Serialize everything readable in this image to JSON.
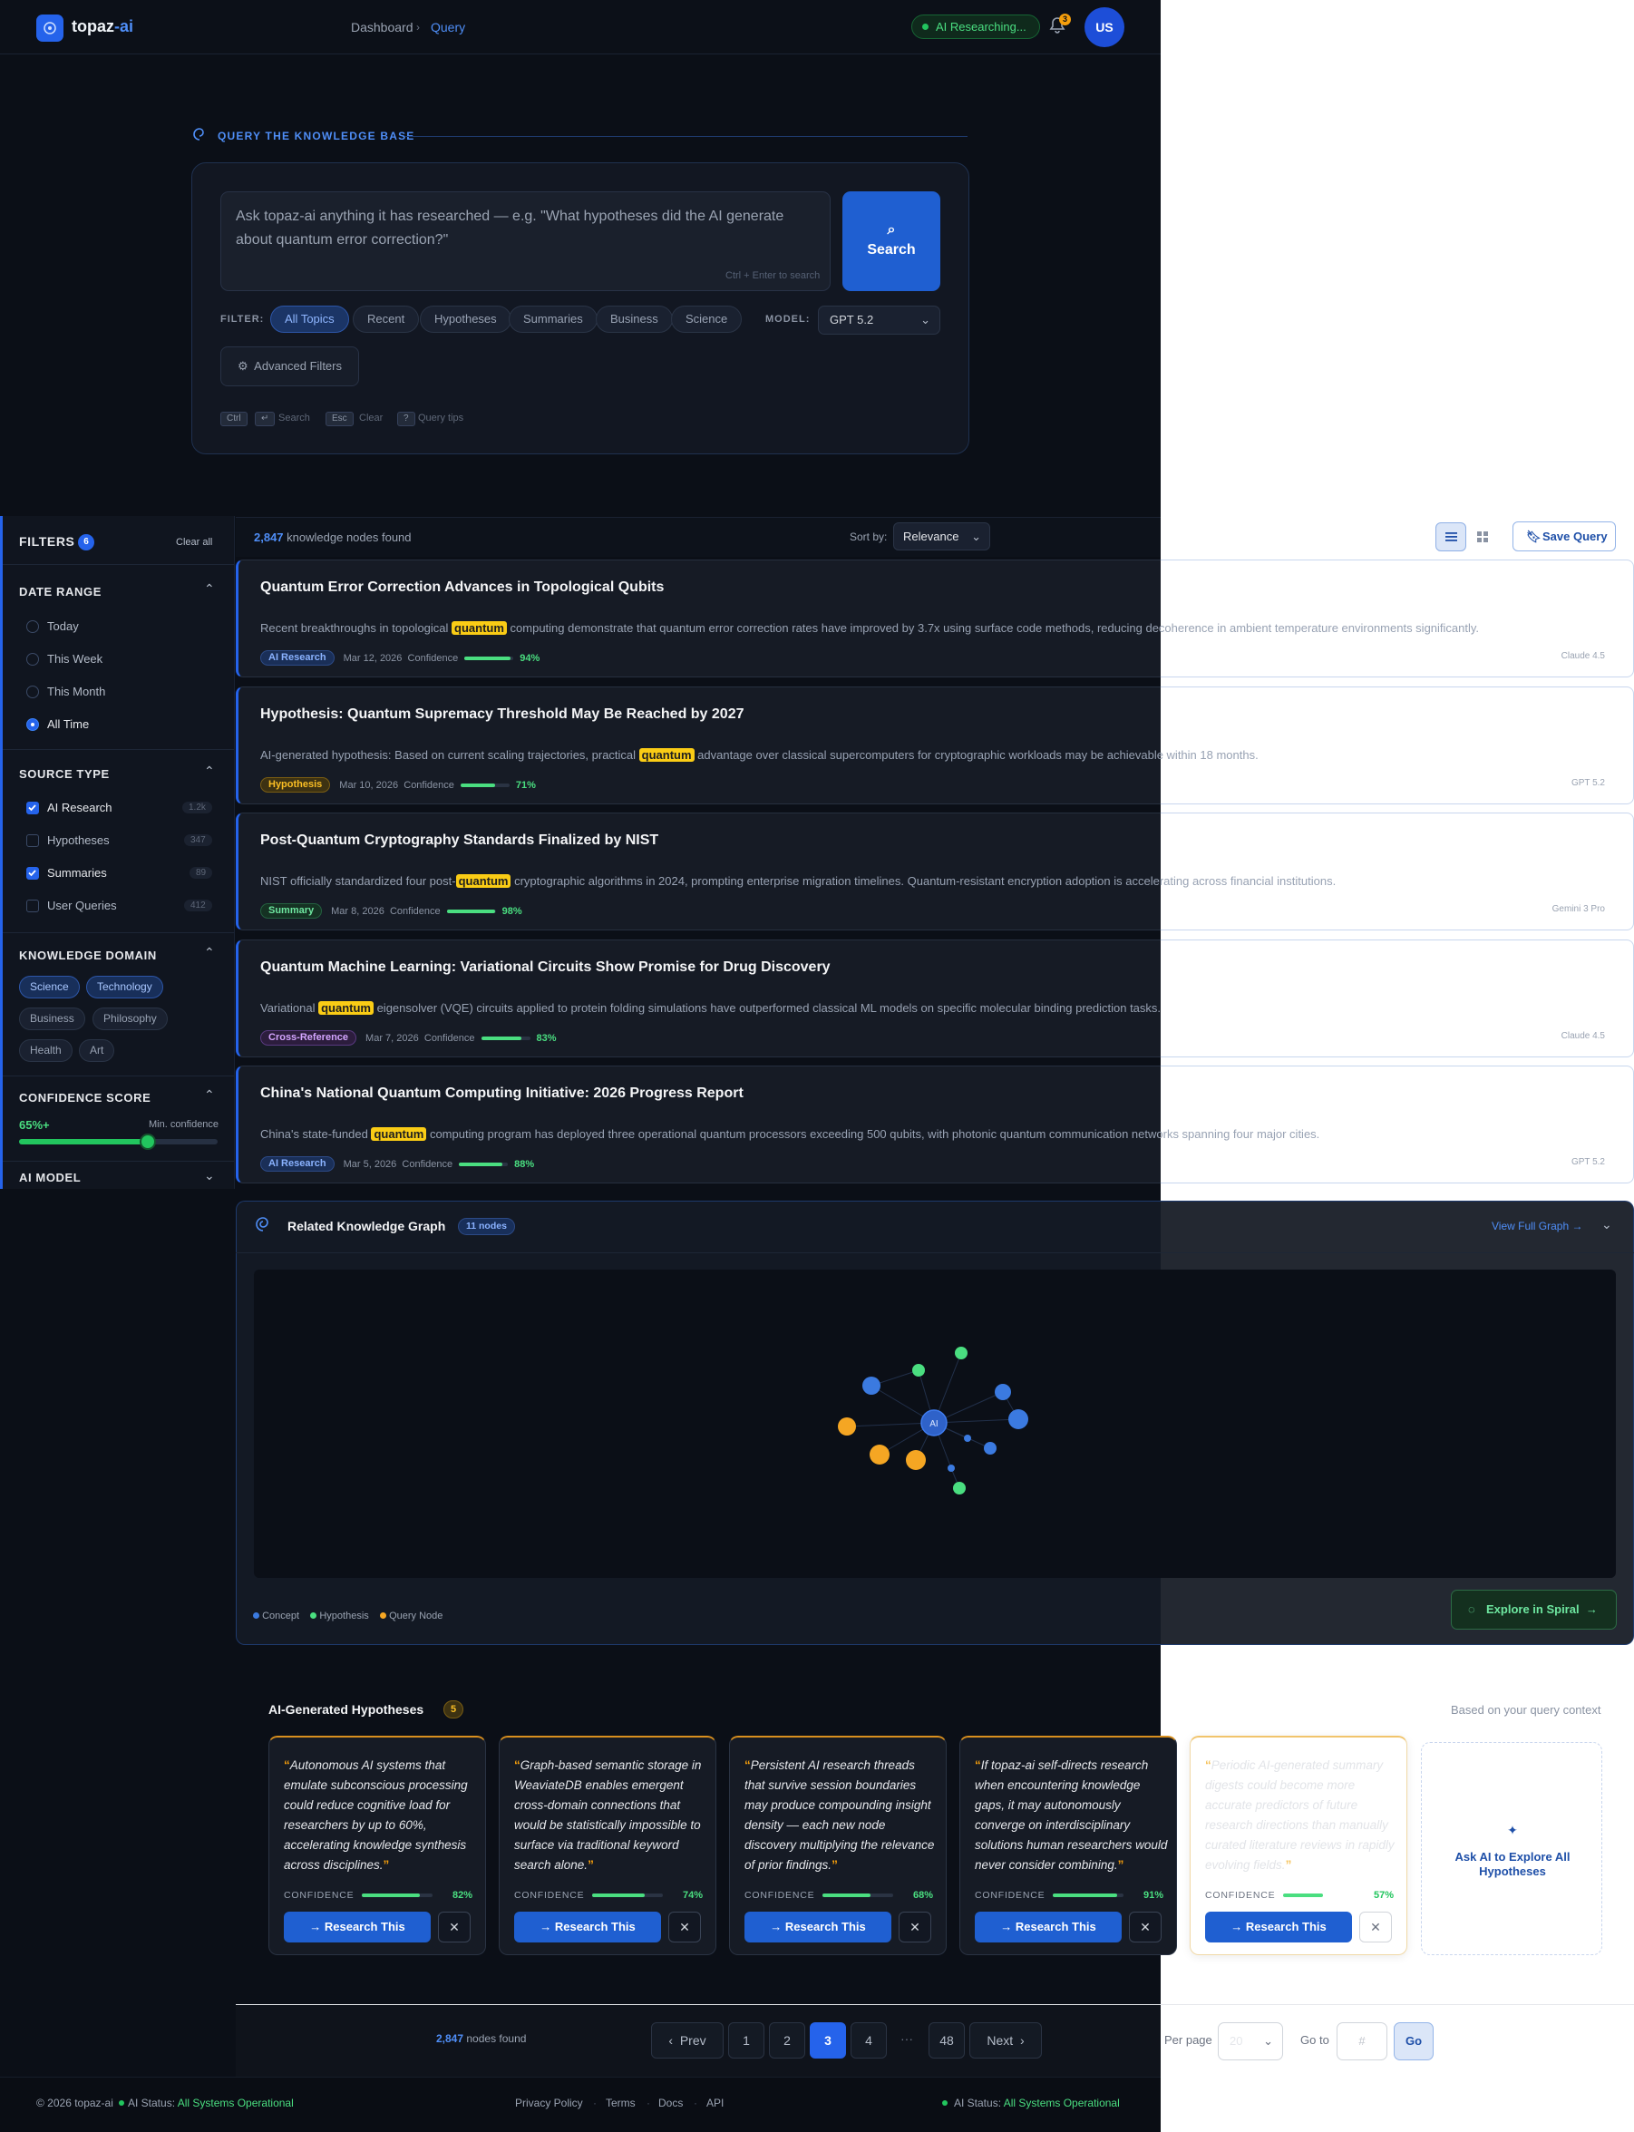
{
  "app": {
    "logo_main": "topaz",
    "logo_accent": "-ai"
  },
  "header": {
    "breadcrumb": [
      "Dashboard",
      "Query"
    ],
    "status": "AI Researching...",
    "notification_count": "3",
    "avatar": "US"
  },
  "query": {
    "section_label": "QUERY THE KNOWLEDGE BASE",
    "placeholder": "Ask topaz-ai anything it has researched — e.g. \"What hypotheses did the AI generate about quantum error correction?\"",
    "shortcut_hint": "Ctrl + Enter to search",
    "search_label": "Search",
    "filter_label": "FILTER:",
    "filters": [
      "All Topics",
      "Recent",
      "Hypotheses",
      "Summaries",
      "Business",
      "Science"
    ],
    "model_label": "MODEL:",
    "model_value": "GPT 5.2",
    "advanced_label": "Advanced Filters",
    "shortcuts": {
      "k1": "Ctrl",
      "k2": "↵",
      "t1": "Search",
      "k3": "Esc",
      "t2": "Clear",
      "k4": "?",
      "t3": "Query tips"
    }
  },
  "results": {
    "count": "2,847",
    "count_suffix": "knowledge nodes found",
    "sort_label": "Sort by:",
    "sort_value": "Relevance",
    "save_label": "Save Query",
    "items": [
      {
        "title": "Quantum Error Correction Advances in Topological Qubits",
        "pre": "Recent breakthroughs in topological ",
        "hl": "quantum",
        "post": " computing demonstrate that quantum error correction rates have improved by 3.7x using surface code methods, reducing decoherence in ambient temperature environments significantly.",
        "badge": "AI Research",
        "date": "Mar 12, 2026",
        "conf_label": "Confidence",
        "confidence": 94,
        "conf_text": "94%",
        "model": "Claude 4.5"
      },
      {
        "title": "Hypothesis: Quantum Supremacy Threshold May Be Reached by 2027",
        "pre": "AI-generated hypothesis: Based on current scaling trajectories, practical ",
        "hl": "quantum",
        "post": " advantage over classical supercomputers for cryptographic workloads may be achievable within 18 months.",
        "badge": "Hypothesis",
        "date": "Mar 10, 2026",
        "conf_label": "Confidence",
        "confidence": 71,
        "conf_text": "71%",
        "model": "GPT 5.2"
      },
      {
        "title": "Post-Quantum Cryptography Standards Finalized by NIST",
        "pre": "NIST officially standardized four post-",
        "hl": "quantum",
        "post": " cryptographic algorithms in 2024, prompting enterprise migration timelines. Quantum-resistant encryption adoption is accelerating across financial institutions.",
        "badge": "Summary",
        "date": "Mar 8, 2026",
        "conf_label": "Confidence",
        "confidence": 98,
        "conf_text": "98%",
        "model": "Gemini 3 Pro"
      },
      {
        "title": "Quantum Machine Learning: Variational Circuits Show Promise for Drug Discovery",
        "pre": "Variational ",
        "hl": "quantum",
        "post": " eigensolver (VQE) circuits applied to protein folding simulations have outperformed classical ML models on specific molecular binding prediction tasks.",
        "badge": "Cross-Reference",
        "date": "Mar 7, 2026",
        "conf_label": "Confidence",
        "confidence": 83,
        "conf_text": "83%",
        "model": "Claude 4.5"
      },
      {
        "title": "China's National Quantum Computing Initiative: 2026 Progress Report",
        "pre": "China's state-funded ",
        "hl": "quantum",
        "post": " computing program has deployed three operational quantum processors exceeding 500 qubits, with photonic quantum communication networks spanning four major cities.",
        "badge": "AI Research",
        "date": "Mar 5, 2026",
        "conf_label": "Confidence",
        "confidence": 88,
        "conf_text": "88%",
        "model": "GPT 5.2"
      }
    ]
  },
  "sidebar": {
    "title": "FILTERS",
    "badge": "6",
    "clear": "Clear all",
    "date_title": "DATE RANGE",
    "date_options": [
      "Today",
      "This Week",
      "This Month",
      "All Time"
    ],
    "source_title": "SOURCE TYPE",
    "sources": [
      {
        "label": "AI Research",
        "count": "1.2k"
      },
      {
        "label": "Hypotheses",
        "count": "347"
      },
      {
        "label": "Summaries",
        "count": "89"
      },
      {
        "label": "User Queries",
        "count": "412"
      }
    ],
    "domain_title": "KNOWLEDGE DOMAIN",
    "domains": [
      "Science",
      "Technology",
      "Business",
      "Philosophy",
      "Health",
      "Art"
    ],
    "confidence_title": "CONFIDENCE SCORE",
    "confidence_value": "65%+",
    "confidence_level": 0.65,
    "confidence_caption": "Min. confidence",
    "model_title": "AI MODEL"
  },
  "graph": {
    "title": "Related Knowledge Graph",
    "nodes_badge": "11 nodes",
    "view_full": "View Full Graph",
    "center_label": "AI",
    "legend": [
      "Concept",
      "Hypothesis",
      "Query Node"
    ],
    "explore": "Explore in Spiral"
  },
  "hypotheses": {
    "title": "AI-Generated Hypotheses",
    "count": "5",
    "context": "Based on your query context",
    "conf_label": "CONFIDENCE",
    "research_label": "→ Research This",
    "dismiss": "✕",
    "items": [
      {
        "text": "Autonomous AI systems that emulate subconscious processing could reduce cognitive load for researchers by up to 60%, accelerating knowledge synthesis across disciplines.",
        "confidence": 82,
        "conf_text": "82%"
      },
      {
        "text": "Graph-based semantic storage in WeaviateDB enables emergent cross-domain connections that would be statistically impossible to surface via traditional keyword search alone.",
        "confidence": 74,
        "conf_text": "74%"
      },
      {
        "text": "Persistent AI research threads that survive session boundaries may produce compounding insight density — each new node discovery multiplying the relevance of prior findings.",
        "confidence": 68,
        "conf_text": "68%"
      },
      {
        "text": "If topaz-ai self-directs research when encountering knowledge gaps, it may autonomously converge on interdisciplinary solutions human researchers would never consider combining.",
        "confidence": 91,
        "conf_text": "91%"
      },
      {
        "text": "Periodic AI-generated summary digests could become more accurate predictors of future research directions than manually curated literature reviews in rapidly evolving fields.",
        "confidence": 57,
        "conf_text": "57%"
      }
    ],
    "explore_all": "Ask AI to Explore All Hypotheses"
  },
  "pagination": {
    "count": "2,847",
    "count_suffix": "nodes found",
    "prev": "Prev",
    "pages": [
      "1",
      "2",
      "3",
      "4",
      "···",
      "48"
    ],
    "next": "Next",
    "per_page_label": "Per page",
    "per_page_value": "20",
    "goto_label": "Go to",
    "goto_placeholder": "#",
    "go": "Go"
  },
  "footer": {
    "copyright": "© 2026 topaz-ai",
    "status_label": "AI Status:",
    "status_value": "All Systems Operational",
    "links": [
      "Privacy Policy",
      "Terms",
      "Docs",
      "API"
    ]
  }
}
